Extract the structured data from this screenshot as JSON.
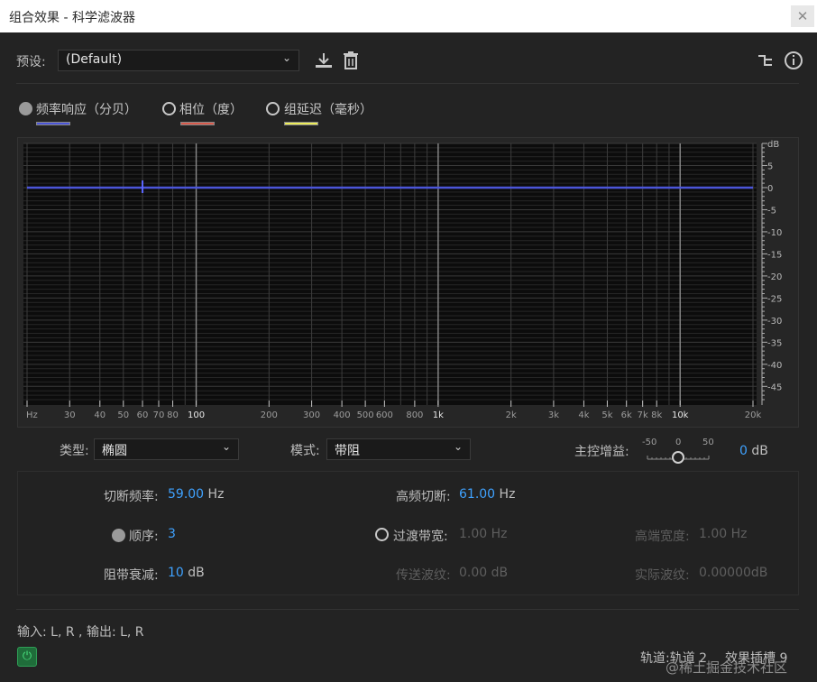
{
  "window": {
    "title": "组合效果 - 科学滤波器",
    "close_glyph": "✕"
  },
  "preset": {
    "label": "预设:",
    "value": "(Default)"
  },
  "icons": [
    "download-icon",
    "trash-icon",
    "routing-icon",
    "info-icon",
    "power-icon",
    "chevron-down-icon"
  ],
  "graph_options": [
    {
      "label": "频率响应（分贝）",
      "selected": true,
      "color": "#4b55d8"
    },
    {
      "label": "相位（度）",
      "selected": false,
      "color": "#d85a4b"
    },
    {
      "label": "组延迟（毫秒）",
      "selected": false,
      "color": "#ecec5a"
    }
  ],
  "chart_data": {
    "type": "line",
    "xlabel": "Hz",
    "ylabel": "dB",
    "x_scale": "log",
    "x_ticks": [
      "Hz",
      "30",
      "40",
      "50",
      "60",
      "70",
      "80",
      "100",
      "200",
      "300",
      "400",
      "500",
      "600",
      "800",
      "1k",
      "2k",
      "3k",
      "4k",
      "5k",
      "6k",
      "7k",
      "8k",
      "10k",
      "20k"
    ],
    "y_ticks": [
      "dB",
      "5",
      "0",
      "-5",
      "-10",
      "-15",
      "-20",
      "-25",
      "-30",
      "-35",
      "-40",
      "-45"
    ],
    "ylim": [
      -48,
      10
    ],
    "series": [
      {
        "x": [
          20,
          20000
        ],
        "y": [
          0,
          0
        ],
        "color": "#4b55d8"
      }
    ],
    "marker_freq": 60
  },
  "controls": {
    "type_label": "类型:",
    "type_value": "椭圆",
    "mode_label": "模式:",
    "mode_value": "带阻",
    "gain_label": "主控增益:",
    "gain_scale": [
      "-50",
      "0",
      "50"
    ],
    "gain_value": "0",
    "gain_unit": "dB"
  },
  "params": {
    "cutoff_label": "切断频率:",
    "cutoff_value": "59.00",
    "cutoff_unit": "Hz",
    "high_cut_label": "高频切断:",
    "high_cut_value": "61.00",
    "high_cut_unit": "Hz",
    "order_label": "顺序:",
    "order_value": "3",
    "transition_label": "过渡带宽:",
    "transition_value": "1.00 Hz",
    "high_width_label": "高端宽度:",
    "high_width_value": "1.00 Hz",
    "stopband_label": "阻带衰减:",
    "stopband_value": "10",
    "stopband_unit": "dB",
    "passband_label": "传送波纹:",
    "passband_value": "0.00 dB",
    "actual_label": "实际波纹:",
    "actual_value": "0.00000dB"
  },
  "footer": {
    "io": "输入: L, R , 输出: L, R",
    "track": "轨道:轨道 2",
    "slot": "效果插槽 9",
    "watermark": "@稀土掘金技术社区"
  }
}
